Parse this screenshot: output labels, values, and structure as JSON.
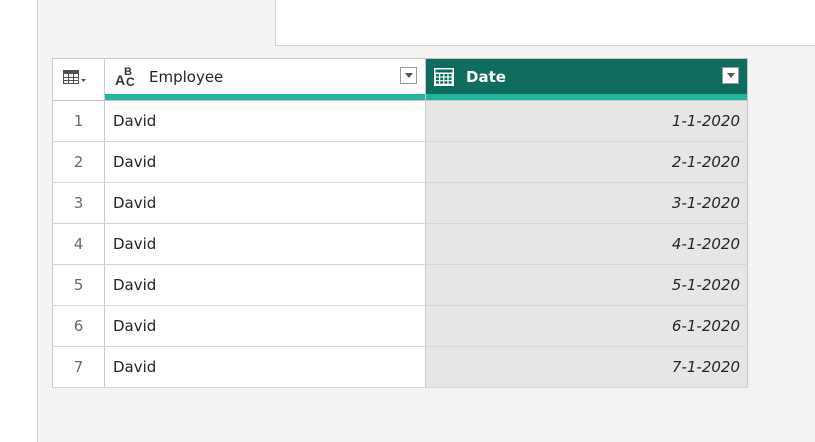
{
  "columns": [
    {
      "name": "Employee",
      "type_icon": "abc-text-type-icon"
    },
    {
      "name": "Date",
      "type_icon": "date-type-icon",
      "selected": true
    }
  ],
  "rows": [
    {
      "num": "1",
      "employee": "David",
      "date": "1-1-2020"
    },
    {
      "num": "2",
      "employee": "David",
      "date": "2-1-2020"
    },
    {
      "num": "3",
      "employee": "David",
      "date": "3-1-2020"
    },
    {
      "num": "4",
      "employee": "David",
      "date": "4-1-2020"
    },
    {
      "num": "5",
      "employee": "David",
      "date": "5-1-2020"
    },
    {
      "num": "6",
      "employee": "David",
      "date": "6-1-2020"
    },
    {
      "num": "7",
      "employee": "David",
      "date": "7-1-2020"
    }
  ],
  "colors": {
    "selected_header": "#106c5e",
    "quality_bar": "#22b59b",
    "selected_column_bg": "#e6e6e6"
  }
}
